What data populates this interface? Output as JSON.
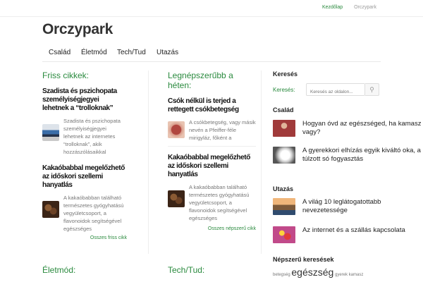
{
  "topbar": {
    "links": [
      "Kezdőlap",
      "Orczypark"
    ]
  },
  "site": {
    "title": "Orczypark"
  },
  "nav": {
    "items": [
      "Család",
      "Életmód",
      "Tech/Tud",
      "Utazás"
    ]
  },
  "fresh": {
    "title": "Friss cikkek:",
    "posts": [
      {
        "title": "Szadista és pszichopata személyiségjegyei lehetnek a “trolloknak”",
        "excerpt": "Szadista és pszichopata személyiségjegyei lehetnek az internetes “trolloknak”, akik hozzászólásaikkal"
      },
      {
        "title": "Kakaóbabbal megelőzhető az időskori szellemi hanyatlás",
        "excerpt": "A kakaóbabban található természetes gyógyhatású vegyületcsoport, a flavonoidok segítségével egészséges"
      }
    ],
    "more": "Osszes friss cikk"
  },
  "popular": {
    "title": "Legnépszerűbb a héten:",
    "posts": [
      {
        "title": "Csók nélkül is terjed a rettegett csókbetegség",
        "excerpt": "A csókbetegség, vagy másik nevén a Pfeiffer-féle mirigyláz, főként a"
      },
      {
        "title": "Kakaóbabbal megelőzhető az időskori szellemi hanyatlás",
        "excerpt": "A kakaóbabban található természetes gyógyhatású vegyületcsoport, a flavonoidok segítségével egészséges"
      }
    ],
    "more": "Osszes népszerű cikk"
  },
  "sidebar": {
    "search_heading": "Keresés",
    "search_label": "Keresés:",
    "search_placeholder": "Keresés az oldalon...",
    "family_heading": "Család",
    "family_items": [
      "Hogyan óvd az egészséged, ha kamasz vagy?",
      "A gyerekkori elhízás egyik kiváltó oka, a túlzott só fogyasztás"
    ],
    "travel_heading": "Utazás",
    "travel_items": [
      "A világ 10 leglátogatottabb nevezetessége",
      "Az internet és a szállás kapcsolata"
    ],
    "popular_heading": "Népszerű keresések",
    "tags": [
      "betegség",
      "egészség",
      "gyerek",
      "kamasz"
    ]
  },
  "bottom": {
    "lifestyle_title": "Életmód:",
    "tech_title": "Tech/Tud:"
  },
  "colors": {
    "accent": "#2a8a3e"
  }
}
